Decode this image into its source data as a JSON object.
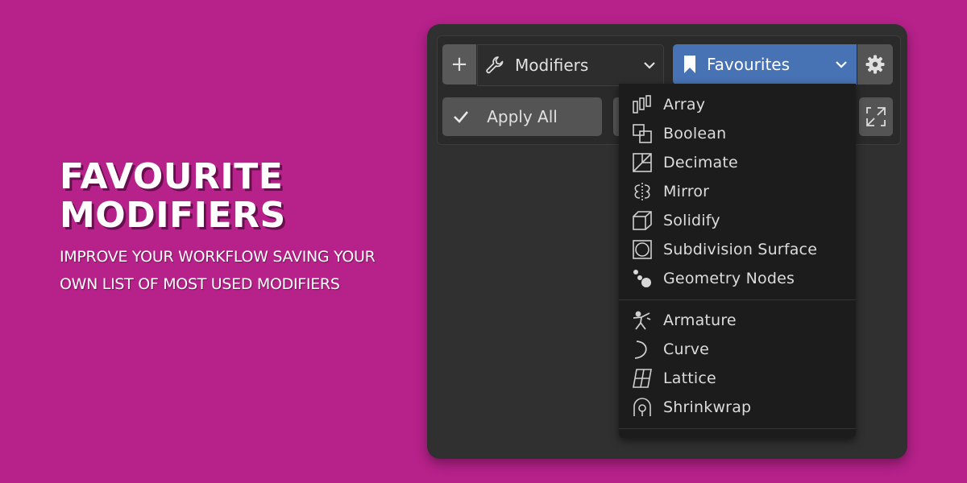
{
  "promo": {
    "title_line1": "FAVOURITE",
    "title_line2": "MODIFIERS",
    "subtitle": "IMPROVE YOUR WORKFLOW SAVING YOUR OWN LIST OF MOST USED MODIFIERS"
  },
  "toolbar": {
    "add_label": "+",
    "modifiers_label": "Modifiers",
    "favourites_label": "Favourites",
    "apply_all_label": "Apply All"
  },
  "menu": {
    "group1": [
      {
        "label": "Array",
        "icon": "array-icon"
      },
      {
        "label": "Boolean",
        "icon": "boolean-icon"
      },
      {
        "label": "Decimate",
        "icon": "decimate-icon"
      },
      {
        "label": "Mirror",
        "icon": "mirror-icon"
      },
      {
        "label": "Solidify",
        "icon": "solidify-icon"
      },
      {
        "label": "Subdivision Surface",
        "icon": "subdivision-icon"
      },
      {
        "label": "Geometry Nodes",
        "icon": "geometry-nodes-icon"
      }
    ],
    "group2": [
      {
        "label": "Armature",
        "icon": "armature-icon"
      },
      {
        "label": "Curve",
        "icon": "curve-icon"
      },
      {
        "label": "Lattice",
        "icon": "lattice-icon"
      },
      {
        "label": "Shrinkwrap",
        "icon": "shrinkwrap-icon"
      }
    ]
  },
  "colors": {
    "background": "#b6218a",
    "accent": "#4772b3",
    "panel": "#303030",
    "menu": "#1c1c1c"
  }
}
